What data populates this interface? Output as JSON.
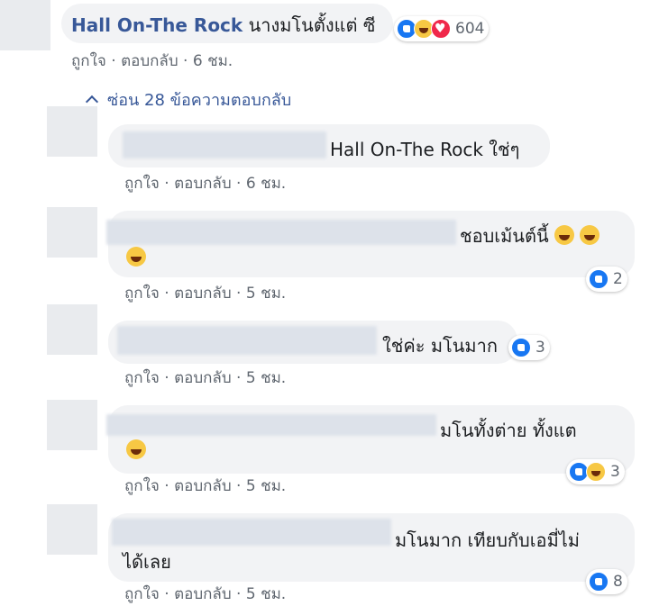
{
  "top_comment": {
    "author": "Hall On-The Rock",
    "text": "นางมโนตั้งแต่ ซี",
    "reaction_count": "604",
    "reaction_icons": [
      "like-icon",
      "haha-icon",
      "love-icon"
    ],
    "like_label": "ถูกใจ",
    "reply_label": "ตอบกลับ",
    "time": "6 ชม."
  },
  "hide_replies": "ซ่อน 28 ข้อความตอบกลับ",
  "replies": [
    {
      "text": "Hall On-The Rock ใช่ๆ",
      "like_label": "ถูกใจ",
      "reply_label": "ตอบกลับ",
      "time": "6 ชม.",
      "reaction_count": ""
    },
    {
      "text": "ชอบเม้นต์นี้",
      "like_label": "ถูกใจ",
      "reply_label": "ตอบกลับ",
      "time": "5 ชม.",
      "reaction_count": "2"
    },
    {
      "text": "ใช่ค่ะ มโนมาก",
      "like_label": "ถูกใจ",
      "reply_label": "ตอบกลับ",
      "time": "5 ชม.",
      "reaction_count": "3"
    },
    {
      "text": "มโนทั้งต่าย ทั้งแต",
      "like_label": "ถูกใจ",
      "reply_label": "ตอบกลับ",
      "time": "5 ชม.",
      "reaction_count": "3"
    },
    {
      "text_line1": "มโนมาก เทียบกับเอมี่ไม่",
      "text_line2": "ได้เลย",
      "like_label": "ถูกใจ",
      "reply_label": "ตอบกลับ",
      "time": "5 ชม.",
      "reaction_count": "8"
    }
  ],
  "sep": " · ",
  "colors": {
    "bubble": "#f2f3f5",
    "link": "#385898",
    "meta": "#606770",
    "like": "#1877f2"
  }
}
